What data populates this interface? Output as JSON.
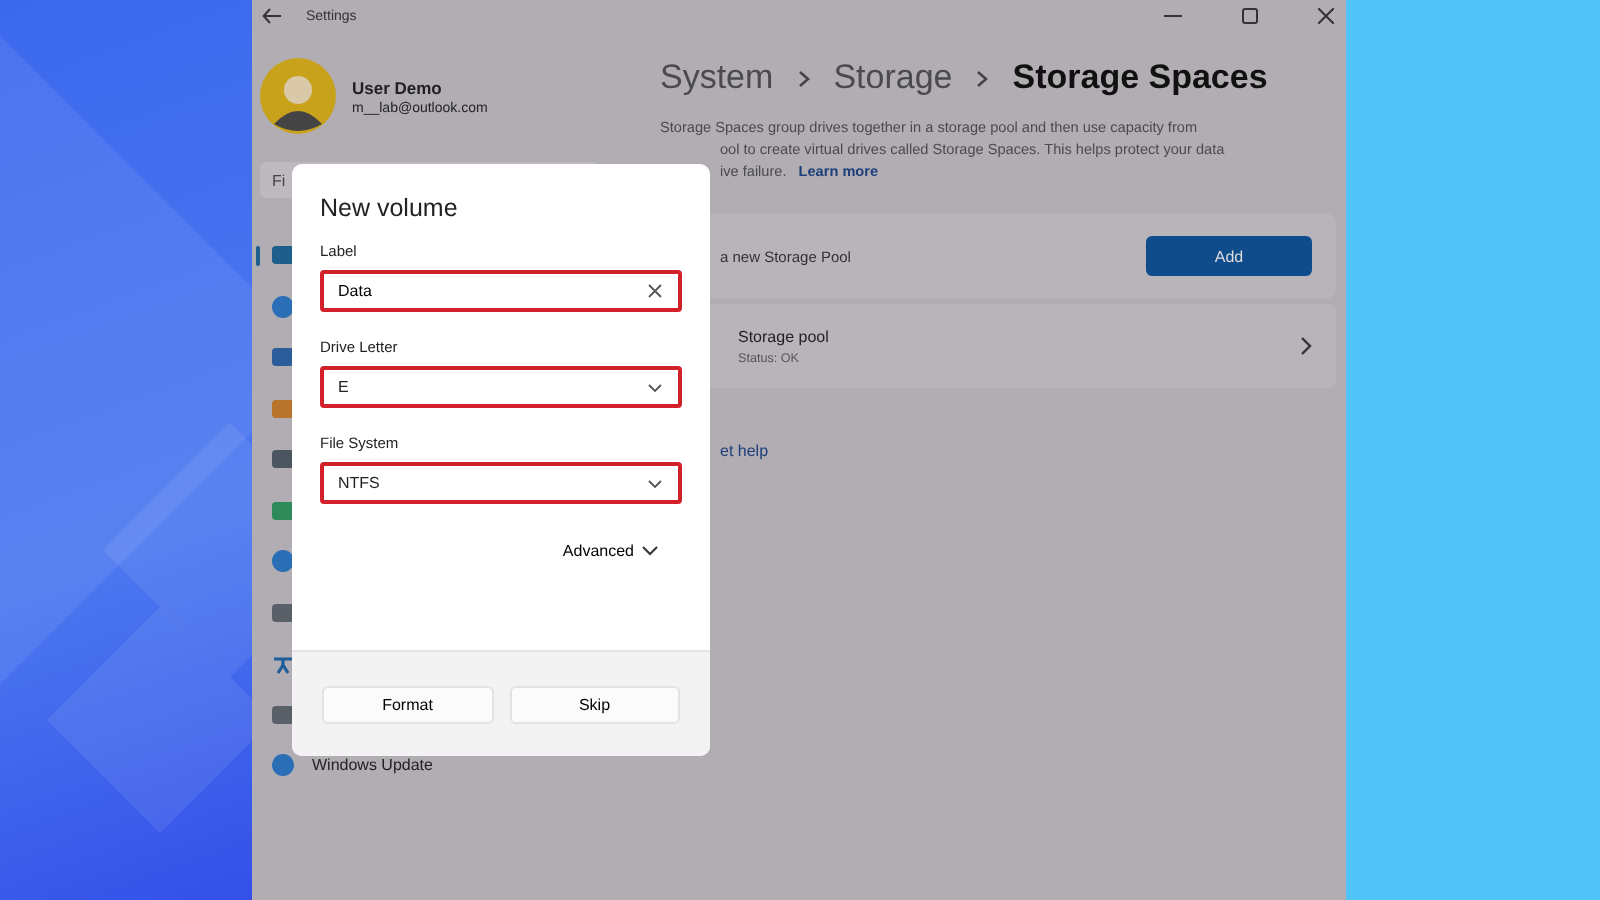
{
  "window": {
    "title": "Settings"
  },
  "user": {
    "name": "User Demo",
    "email": "m__lab@outlook.com"
  },
  "search": {
    "placeholder": "Fi"
  },
  "nav_items": [
    {
      "kind": "system",
      "selected": true
    },
    {
      "kind": "bluetooth",
      "selected": false
    },
    {
      "kind": "network",
      "selected": false
    },
    {
      "kind": "personalization",
      "selected": false
    },
    {
      "kind": "apps",
      "selected": false
    },
    {
      "kind": "accounts",
      "selected": false
    },
    {
      "kind": "time",
      "selected": false
    },
    {
      "kind": "gaming",
      "selected": false
    },
    {
      "kind": "accessibility",
      "selected": false
    },
    {
      "kind": "privacy",
      "selected": false
    },
    {
      "kind": "update",
      "selected": false,
      "label": "Windows Update"
    }
  ],
  "breadcrumb": [
    {
      "label": "System",
      "current": false
    },
    {
      "label": "Storage",
      "current": false
    },
    {
      "label": "Storage Spaces",
      "current": true
    }
  ],
  "description": {
    "lines": [
      "Storage Spaces group drives together in a storage pool and then use capacity from",
      "ool to create virtual drives called Storage Spaces. This helps protect your data",
      "ive failure."
    ],
    "link": "Learn more"
  },
  "create_card": {
    "text": "a new Storage Pool",
    "button": "Add"
  },
  "pool_card": {
    "name": "Storage pool",
    "status": "Status: OK"
  },
  "help_link": "et help",
  "dialog": {
    "title": "New volume",
    "fields": [
      {
        "label": "Label",
        "kind": "text",
        "value": "Data",
        "highlighted": true
      },
      {
        "label": "Drive Letter",
        "kind": "select",
        "value": "E",
        "highlighted": true
      },
      {
        "label": "File System",
        "kind": "select",
        "value": "NTFS",
        "highlighted": true
      }
    ],
    "advanced": "Advanced",
    "buttons": [
      "Format",
      "Skip"
    ]
  }
}
